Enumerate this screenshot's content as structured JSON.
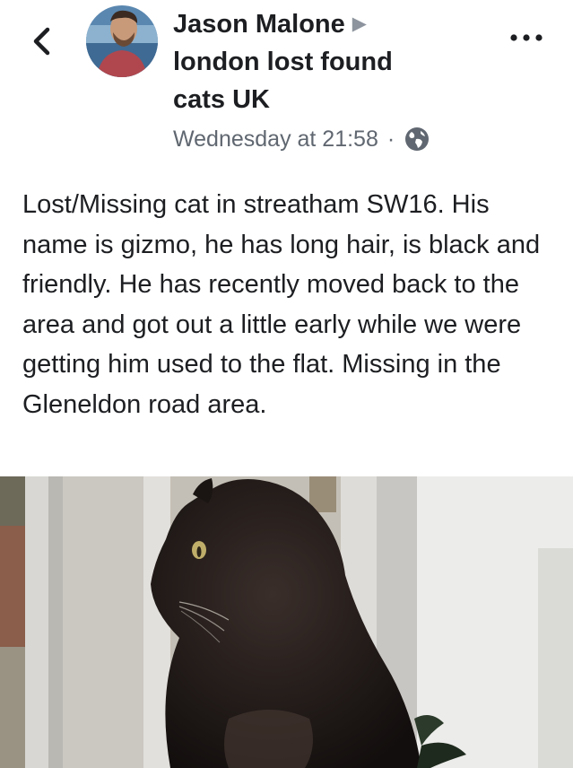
{
  "post": {
    "author": "Jason Malone",
    "group_line1": "london lost found",
    "group_line2": "cats UK",
    "timestamp": "Wednesday at 21:58",
    "separator": "·",
    "privacy_icon": "globe-icon",
    "text": "Lost/Missing cat in streatham SW16. His name is gizmo, he has long hair, is black and friendly. He has recently moved back to the area and got out a little early while we were getting him used to the flat. Missing in the Gleneldon road area."
  },
  "icons": {
    "back": "chevron-left-icon",
    "more": "more-options-icon",
    "arrow": "triangle-right-icon"
  }
}
